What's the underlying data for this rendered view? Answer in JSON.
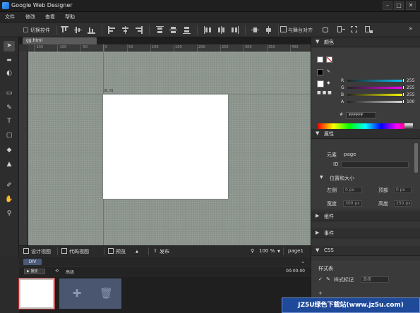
{
  "window": {
    "title": "Google Web Designer",
    "controls": [
      "–",
      "□",
      "✕"
    ]
  },
  "menu": [
    "文件",
    "修改",
    "查看",
    "帮助"
  ],
  "toolbar": {
    "checkbox_label": "切换控件",
    "align_label": "与舞台对齐"
  },
  "tools": [
    {
      "icon": "select-arrow-icon",
      "glyph": "➤"
    },
    {
      "icon": "transform-3d-icon",
      "glyph": "⬌"
    },
    {
      "icon": "rotate-3d-icon",
      "glyph": "◐"
    },
    {
      "icon": "tag-icon",
      "glyph": "▭"
    },
    {
      "icon": "pen-icon",
      "glyph": "✎"
    },
    {
      "icon": "text-icon",
      "glyph": "T"
    },
    {
      "icon": "shape-icon",
      "glyph": "▢"
    },
    {
      "icon": "fill-icon",
      "glyph": "◆"
    },
    {
      "icon": "stroke-icon",
      "glyph": "▲"
    },
    {
      "icon": "color-picker-icon",
      "glyph": "✐"
    },
    {
      "icon": "hand-icon",
      "glyph": "✋"
    },
    {
      "icon": "zoom-icon",
      "glyph": "⚲"
    }
  ],
  "document": {
    "tab": "gg.html"
  },
  "rulers": {
    "top": [
      "-150",
      "-100",
      "-50",
      "0",
      "50",
      "100",
      "150",
      "200",
      "250",
      "300",
      "350",
      "400"
    ],
    "origin": "(0, 0)"
  },
  "viewbar": {
    "design_view": "设计视图",
    "code_view": "代码视图",
    "preview": "预览",
    "publish": "发布",
    "zoom": "100 %",
    "page": "page1"
  },
  "timeline": {
    "tag": "DIV",
    "play": "播放",
    "mode": "高级",
    "time": "00:00.00"
  },
  "panels": {
    "color": {
      "title": "颜色",
      "channels": [
        {
          "label": "R",
          "value": "255"
        },
        {
          "label": "G",
          "value": "255"
        },
        {
          "label": "B",
          "value": "255"
        },
        {
          "label": "A",
          "value": "100"
        }
      ],
      "hex_prefix": "#",
      "hex": "FFFFFF"
    },
    "properties": {
      "title": "属性",
      "element_label": "元素",
      "element_value": "page",
      "id_label": "ID",
      "section": "位置和大小",
      "left_label": "左侧",
      "left_value": "0 px",
      "top_label": "顶部",
      "top_value": "0 px",
      "width_label": "宽度",
      "width_value": "300 px",
      "height_label": "高度",
      "height_value": "250 px"
    },
    "components": {
      "title": "组件"
    },
    "events": {
      "title": "事件"
    },
    "css": {
      "title": "CSS",
      "style_label": "样式表",
      "rule_label": "样式标记",
      "rule_value": "选择",
      "add": "+"
    }
  },
  "watermark": "JZ5U绿色下载站(www.jz5u.com)",
  "colors": {
    "stage": "#8c948d",
    "page": "#ffffff",
    "r_slider": "#00c8ff",
    "g_slider": "#ff00ff",
    "b_slider": "#ffff00",
    "a_slider": "#d9d9d9"
  }
}
